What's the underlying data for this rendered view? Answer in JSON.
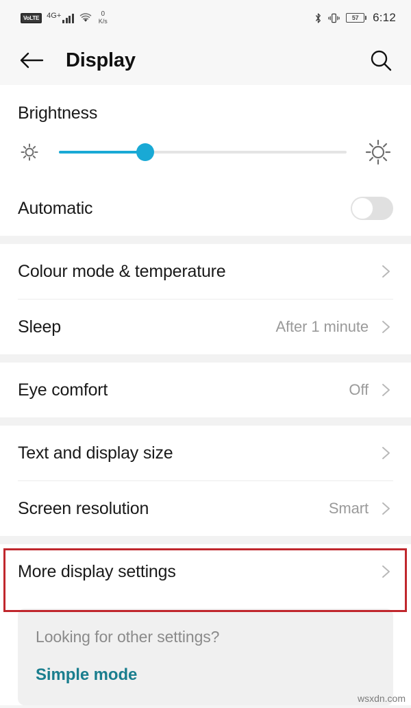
{
  "status_bar": {
    "volte_label": "VoLTE",
    "network_type": "4G+",
    "signal_bars": 4,
    "wifi_icon": "wifi-icon",
    "data_speed_value": "0",
    "data_speed_unit": "K/s",
    "bluetooth_icon": "bluetooth-icon",
    "vibrate_icon": "vibrate-icon",
    "battery_percent": "57",
    "time": "6:12"
  },
  "app_bar": {
    "back_icon": "back-arrow-icon",
    "title": "Display",
    "search_icon": "search-icon"
  },
  "brightness": {
    "section_title": "Brightness",
    "slider_value": 30,
    "accent_color": "#19a9d5",
    "low_icon": "sun-low-icon",
    "high_icon": "sun-high-icon",
    "automatic": {
      "label": "Automatic",
      "enabled": false
    }
  },
  "groups": [
    {
      "rows": [
        {
          "label": "Colour mode & temperature",
          "value": "",
          "chevron": true
        },
        {
          "label": "Sleep",
          "value": "After 1 minute",
          "chevron": true
        }
      ]
    },
    {
      "rows": [
        {
          "label": "Eye comfort",
          "value": "Off",
          "chevron": true
        }
      ]
    },
    {
      "rows": [
        {
          "label": "Text and display size",
          "value": "",
          "chevron": true
        },
        {
          "label": "Screen resolution",
          "value": "Smart",
          "chevron": true
        }
      ]
    },
    {
      "rows": [
        {
          "label": "More display settings",
          "value": "",
          "chevron": true
        }
      ]
    }
  ],
  "footer": {
    "question": "Looking for other settings?",
    "link_label": "Simple mode",
    "link_color": "#1a7e8e"
  },
  "annotation": {
    "target": "More display settings",
    "color": "#c0272d"
  },
  "watermark": "wsxdn.com"
}
